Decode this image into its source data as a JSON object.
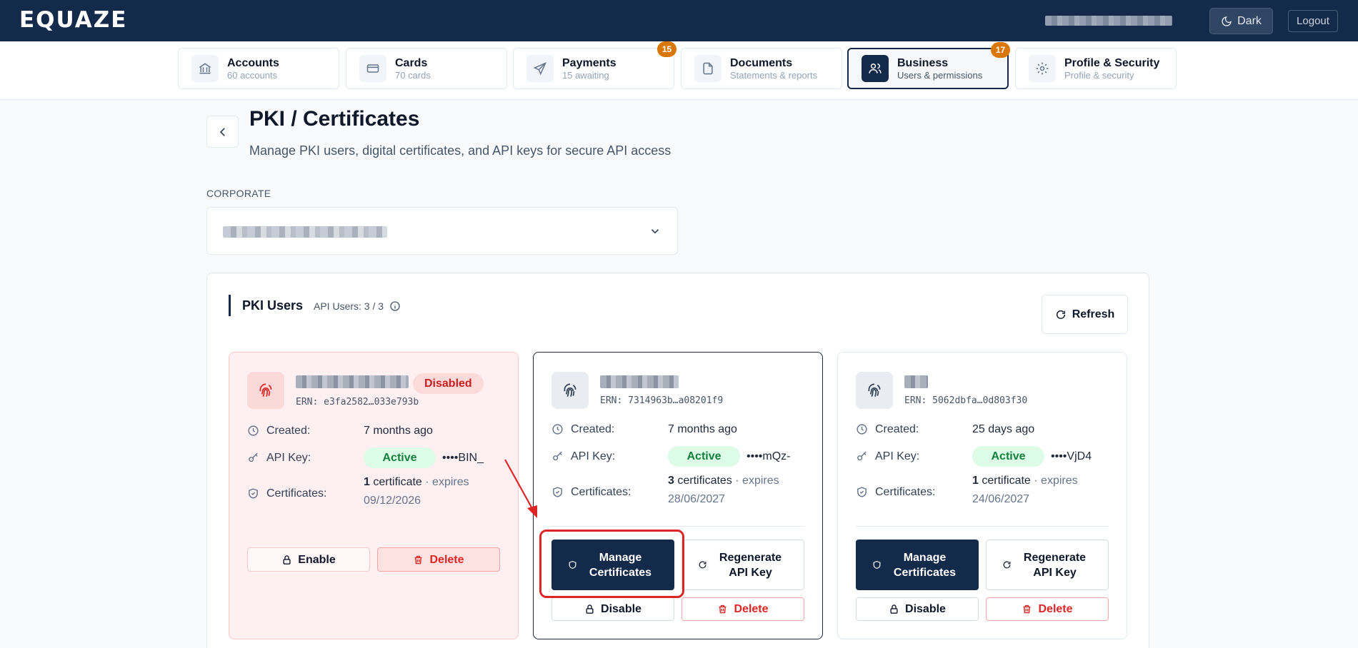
{
  "header": {
    "logo": "EQUAZE",
    "dark_label": "Dark",
    "logout_label": "Logout"
  },
  "nav": {
    "tabs": [
      {
        "title": "Accounts",
        "sub": "60 accounts",
        "icon": "bank-icon"
      },
      {
        "title": "Cards",
        "sub": "70 cards",
        "icon": "card-icon"
      },
      {
        "title": "Payments",
        "sub": "15 awaiting",
        "icon": "send-icon",
        "badge": "15"
      },
      {
        "title": "Documents",
        "sub": "Statements & reports",
        "icon": "document-icon"
      },
      {
        "title": "Business",
        "sub": "Users & permissions",
        "icon": "users-icon",
        "badge": "17",
        "active": true
      },
      {
        "title": "Profile & Security",
        "sub": "Profile & security",
        "icon": "gear-icon"
      }
    ]
  },
  "page": {
    "title": "PKI / Certificates",
    "subtitle": "Manage PKI users, digital certificates, and API keys for secure API access",
    "corporate_label": "CORPORATE"
  },
  "section": {
    "title": "PKI Users",
    "count": "API Users: 3 / 3",
    "refresh_label": "Refresh"
  },
  "labels": {
    "created": "Created:",
    "api_key": "API Key:",
    "certificates": "Certificates:",
    "manage": "Manage Certificates",
    "regenerate": "Regenerate API Key",
    "disable": "Disable",
    "enable": "Enable",
    "delete": "Delete"
  },
  "users": [
    {
      "status": "Disabled",
      "ern": "ERN: e3fa2582…033e793b",
      "created": "7 months ago",
      "api_key_status": "Active",
      "api_key_tail": "••••BIN_",
      "cert_count": "1",
      "cert_word": "certificate",
      "cert_expires": "· expires",
      "cert_date": "09/12/2026"
    },
    {
      "ern": "ERN: 7314963b…a08201f9",
      "created": "7 months ago",
      "api_key_status": "Active",
      "api_key_tail": "••••mQz-",
      "cert_count": "3",
      "cert_word": "certificates",
      "cert_expires": "· expires",
      "cert_date": "28/06/2027"
    },
    {
      "ern": "ERN: 5062dbfa…0d803f30",
      "created": "25 days ago",
      "api_key_status": "Active",
      "api_key_tail": "••••VjD4",
      "cert_count": "1",
      "cert_word": "certificate",
      "cert_expires": "· expires",
      "cert_date": "24/06/2027"
    }
  ],
  "colors": {
    "brand": "#132a4a",
    "badge": "#d97706",
    "danger": "#dc2626",
    "success": "#15803d"
  }
}
